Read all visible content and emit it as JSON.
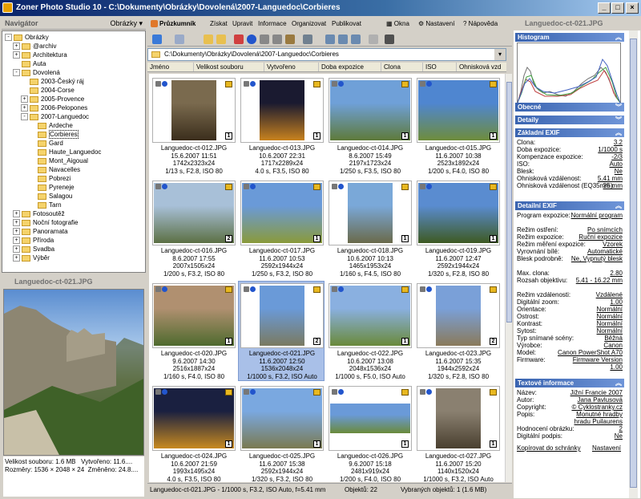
{
  "window": {
    "title": "Zoner Photo Studio 10 - C:\\Dokumenty\\Obrázky\\Dovolená\\2007-Languedoc\\Corbieres"
  },
  "navigator": {
    "title": "Navigátor",
    "dropdown": "Obrázky",
    "tree": [
      {
        "label": "Obrázky",
        "level": 0,
        "pm": "-"
      },
      {
        "label": "@archiv",
        "level": 1,
        "pm": "+"
      },
      {
        "label": "Architektura",
        "level": 1,
        "pm": "+"
      },
      {
        "label": "Auta",
        "level": 1,
        "pm": ""
      },
      {
        "label": "Dovolená",
        "level": 1,
        "pm": "-"
      },
      {
        "label": "2003-Český ráj",
        "level": 2,
        "pm": ""
      },
      {
        "label": "2004-Corse",
        "level": 2,
        "pm": ""
      },
      {
        "label": "2005-Provence",
        "level": 2,
        "pm": "+"
      },
      {
        "label": "2006-Pelopones",
        "level": 2,
        "pm": "+"
      },
      {
        "label": "2007-Languedoc",
        "level": 2,
        "pm": "-"
      },
      {
        "label": "Ardeche",
        "level": 3,
        "pm": ""
      },
      {
        "label": "Corbieres",
        "level": 3,
        "pm": "",
        "selected": true
      },
      {
        "label": "Gard",
        "level": 3,
        "pm": ""
      },
      {
        "label": "Haute_Languedoc",
        "level": 3,
        "pm": ""
      },
      {
        "label": "Mont_Aigoual",
        "level": 3,
        "pm": ""
      },
      {
        "label": "Navacelles",
        "level": 3,
        "pm": ""
      },
      {
        "label": "Pobrezi",
        "level": 3,
        "pm": ""
      },
      {
        "label": "Pyreneje",
        "level": 3,
        "pm": ""
      },
      {
        "label": "Salagou",
        "level": 3,
        "pm": ""
      },
      {
        "label": "Tarn",
        "level": 3,
        "pm": ""
      },
      {
        "label": "Fotosoutěž",
        "level": 1,
        "pm": "+"
      },
      {
        "label": "Noční fotografie",
        "level": 1,
        "pm": "+"
      },
      {
        "label": "Panoramata",
        "level": 1,
        "pm": "+"
      },
      {
        "label": "Příroda",
        "level": 1,
        "pm": "+"
      },
      {
        "label": "Svadba",
        "level": 1,
        "pm": "+"
      },
      {
        "label": "Výběr",
        "level": 1,
        "pm": "+"
      }
    ]
  },
  "preview": {
    "title": "Languedoc-ct-021.JPG",
    "size_label": "Velikost souboru: 1.6 MB",
    "created_label": "Vytvořeno: 11.6....",
    "dims_label": "Rozměry: 1536 × 2048 × 24",
    "changed_label": "Změněno: 24.8...."
  },
  "menu": {
    "tab": "Průzkumník",
    "items": [
      "Získat",
      "Upravit",
      "Informace",
      "Organizovat",
      "Publikovat"
    ],
    "right": [
      "Okna",
      "Nastavení",
      "Nápověda"
    ]
  },
  "path": "C:\\Dokumenty\\Obrázky\\Dovolená\\2007-Languedoc\\Corbieres",
  "columns": [
    "Jméno",
    "Velikost souboru",
    "Vytvořeno",
    "Doba expozice",
    "Clona",
    "ISO",
    "Ohnisková vzd"
  ],
  "images": [
    {
      "name": "Languedoc-ct-012.JPG",
      "date": "15.6.2007 11:51",
      "dims": "1742x2323x24",
      "exif": "1/13 s, F2.8, ISO 80",
      "rating": "1",
      "orient": "p",
      "c1": "#7a6a4e",
      "c2": "#3b2e1c"
    },
    {
      "name": "Languedoc-ct-013.JPG",
      "date": "10.6.2007 22:31",
      "dims": "1717x2289x24",
      "exif": "4.0 s, F3.5, ISO 80",
      "rating": "1",
      "orient": "p",
      "c1": "#1a1a30",
      "c2": "#c8821e"
    },
    {
      "name": "Languedoc-ct-014.JPG",
      "date": "8.6.2007 15:49",
      "dims": "2197x1723x24",
      "exif": "1/250 s, F3.5, ISO 80",
      "rating": "1",
      "orient": "l",
      "c1": "#6fa0d8",
      "c2": "#5e7a3a"
    },
    {
      "name": "Languedoc-ct-015.JPG",
      "date": "11.6.2007 10:38",
      "dims": "2523x1892x24",
      "exif": "1/200 s, F4.0, ISO 80",
      "rating": "1",
      "orient": "l",
      "c1": "#4f86d0",
      "c2": "#6e8c3c"
    },
    {
      "name": "Languedoc-ct-016.JPG",
      "date": "8.6.2007 17:55",
      "dims": "2007x1505x24",
      "exif": "1/200 s, F3.2, ISO 80",
      "rating": "2",
      "orient": "l",
      "c1": "#a8c0d8",
      "c2": "#5c7044"
    },
    {
      "name": "Languedoc-ct-017.JPG",
      "date": "11.6.2007 10:53",
      "dims": "2592x1944x24",
      "exif": "1/250 s, F3.2, ISO 80",
      "rating": "1",
      "orient": "l",
      "c1": "#6a9ad8",
      "c2": "#8a9a3a"
    },
    {
      "name": "Languedoc-ct-018.JPG",
      "date": "10.6.2007 10:13",
      "dims": "1465x1953x24",
      "exif": "1/160 s, F4.5, ISO 80",
      "rating": "1",
      "orient": "p",
      "c1": "#7aa8d8",
      "c2": "#6a6a4a"
    },
    {
      "name": "Languedoc-ct-019.JPG",
      "date": "11.6.2007 12:47",
      "dims": "2592x1944x24",
      "exif": "1/320 s, F2.8, ISO 80",
      "rating": "1",
      "orient": "l",
      "c1": "#5a8cd0",
      "c2": "#3e5a22"
    },
    {
      "name": "Languedoc-ct-020.JPG",
      "date": "9.6.2007 14:30",
      "dims": "2516x1887x24",
      "exif": "1/160 s, F4.0, ISO 80",
      "rating": "1",
      "orient": "l",
      "c1": "#b09070",
      "c2": "#4e6a2e"
    },
    {
      "name": "Languedoc-ct-021.JPG",
      "date": "11.6.2007 12:50",
      "dims": "1536x2048x24",
      "exif": "1/1000 s, F3.2, ISO Auto",
      "rating": "2",
      "orient": "p",
      "c1": "#6a9ad8",
      "c2": "#7a7a60",
      "selected": true
    },
    {
      "name": "Languedoc-ct-022.JPG",
      "date": "10.6.2007 13:08",
      "dims": "2048x1536x24",
      "exif": "1/1000 s, F5.0, ISO Auto",
      "rating": "1",
      "orient": "l",
      "c1": "#8ab0e0",
      "c2": "#6a8a3a"
    },
    {
      "name": "Languedoc-ct-023.JPG",
      "date": "11.6.2007 15:35",
      "dims": "1944x2592x24",
      "exif": "1/320 s, F2.8, ISO 80",
      "rating": "2",
      "orient": "p",
      "c1": "#7aa0d8",
      "c2": "#8a7a5a"
    },
    {
      "name": "Languedoc-ct-024.JPG",
      "date": "10.6.2007 21:59",
      "dims": "1993x1495x24",
      "exif": "4.0 s, F3.5, ISO 80",
      "rating": "1",
      "orient": "l",
      "c1": "#1a2040",
      "c2": "#c88a20"
    },
    {
      "name": "Languedoc-ct-025.JPG",
      "date": "11.6.2007 15:38",
      "dims": "2592x1944x24",
      "exif": "1/320 s, F3.2, ISO 80",
      "rating": "1",
      "orient": "l",
      "c1": "#7aa8e0",
      "c2": "#7a7a50"
    },
    {
      "name": "Languedoc-ct-026.JPG",
      "date": "9.6.2007 15:18",
      "dims": "2481x919x24",
      "exif": "1/200 s, F4.0, ISO 80",
      "rating": "1",
      "orient": "w",
      "c1": "#6a9ad8",
      "c2": "#6a8a3a"
    },
    {
      "name": "Languedoc-ct-027.JPG",
      "date": "11.6.2007 15:20",
      "dims": "1140x1520x24",
      "exif": "1/1000 s, F3.2, ISO Auto",
      "rating": "1",
      "orient": "p",
      "c1": "#8a8070",
      "c2": "#4a4030"
    }
  ],
  "status": {
    "selection": "Languedoc-ct-021.JPG - 1/1000 s, F3.2, ISO Auto, f=5.41 mm",
    "objects": "Objektů: 22",
    "selected": "Vybraných objektů: 1 (1.6 MB)"
  },
  "right": {
    "title": "Languedoc-ct-021.JPG",
    "sections": {
      "histogram": "Histogram",
      "general": "Obecné",
      "details": "Detaily",
      "basic_exif": "Základní EXIF",
      "detail_exif": "Detailní EXIF",
      "text_info": "Textové informace"
    },
    "basic": [
      [
        "Clona:",
        "3.2"
      ],
      [
        "Doba expozice:",
        "1/1000 s"
      ],
      [
        "Kompenzace expozice:",
        "-2/3"
      ],
      [
        "ISO:",
        "Auto"
      ],
      [
        "Blesk:",
        "Ne"
      ],
      [
        "Ohnisková vzdálenost:",
        "5.41 mm"
      ],
      [
        "Ohnisková vzdálenost (EQ35mm):",
        "35 mm"
      ]
    ],
    "detail": [
      [
        "Program expozice:",
        "Normální program"
      ],
      [
        "Režim ostření:",
        "Po snímcích"
      ],
      [
        "Režim expozice:",
        "Ruční expozice"
      ],
      [
        "Režim měření expozice:",
        "Vzorek"
      ],
      [
        "Vyrovnání bílé:",
        "Automatické"
      ],
      [
        "Blesk podrobně:",
        "Ne, Vypnutý blesk"
      ],
      [
        "Max. clona:",
        "2.80"
      ],
      [
        "Rozsah objektivu:",
        "5.41 - 16.22 mm"
      ],
      [
        "Režim vzdálenosti:",
        "Vzdálené"
      ],
      [
        "Digitální zoom:",
        "1.00"
      ],
      [
        "Orientace:",
        "Normální"
      ],
      [
        "Ostrost:",
        "Normální"
      ],
      [
        "Kontrast:",
        "Normální"
      ],
      [
        "Sytost:",
        "Normální"
      ],
      [
        "Typ snímané scény:",
        "Běžná"
      ],
      [
        "Výrobce:",
        "Canon"
      ],
      [
        "Model:",
        "Canon PowerShot A70"
      ],
      [
        "Firmware:",
        "Firmware Version 1.00"
      ]
    ],
    "text": [
      [
        "Název:",
        "Jižní Francie 2007"
      ],
      [
        "Autor:",
        "Jana Pavlusová"
      ],
      [
        "Copyright:",
        "© Cyklostranky.cz"
      ],
      [
        "Popis:",
        "Monutné hradby hradu Puilaurens"
      ],
      [
        "Hodnocení obrázku:",
        "2"
      ],
      [
        "Digitální podpis:",
        "Ne"
      ]
    ],
    "links": {
      "copy": "Kopírovat do schránky",
      "settings": "Nastavení"
    }
  }
}
